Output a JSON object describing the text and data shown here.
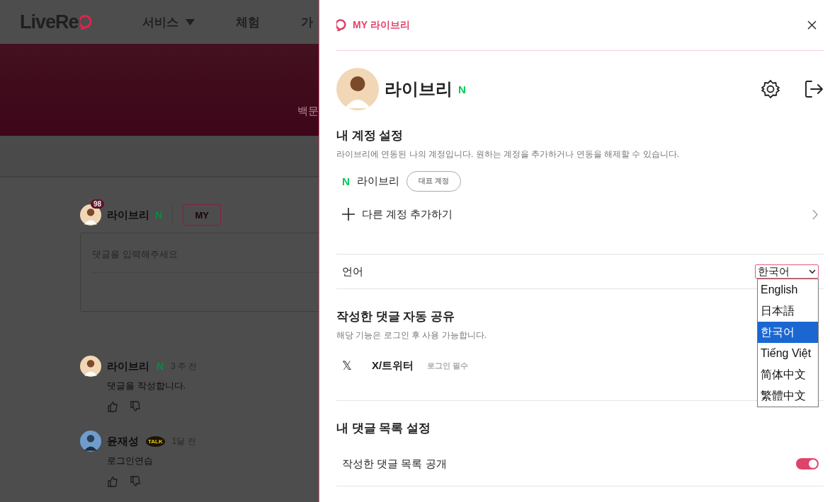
{
  "background_page": {
    "logo": "LiveRe",
    "nav": [
      {
        "label": "서비스",
        "dropdown": true
      },
      {
        "label": "체험",
        "dropdown": false
      },
      {
        "label": "가",
        "dropdown": false
      }
    ],
    "hero_text": "백문",
    "composer": {
      "user": "라이브리",
      "badge": "98",
      "provider": "N",
      "my_button": "MY",
      "placeholder": "댓글을 입력해주세요"
    },
    "comments": [
      {
        "user": "라이브리",
        "kind": "naver",
        "provider_label": "N",
        "time": "3 주 전",
        "text": "댓글을 작성합니다."
      },
      {
        "user": "윤재성",
        "kind": "kakao",
        "provider_label": "TALK",
        "time": "1달 전",
        "text": "로그인연습"
      }
    ]
  },
  "panel": {
    "title": "MY 라이브리",
    "profile": {
      "name": "라이브리",
      "provider": "N"
    },
    "account_section": {
      "title": "내 계정 설정",
      "description": "라이브리에 연동된 나의 계정입니다. 원하는 계정을 추가하거나 연동을 해제할 수 있습니다.",
      "accounts": [
        {
          "provider": "N",
          "name": "라이브리",
          "tag": "대표 계정"
        }
      ],
      "add_account": "다른 계정 추가하기"
    },
    "language": {
      "label": "언어",
      "value": "한국어",
      "expanded": true,
      "options": [
        {
          "label": "English",
          "selected": false
        },
        {
          "label": "日本語",
          "selected": false
        },
        {
          "label": "한국어",
          "selected": true
        },
        {
          "label": "Tiếng Việt",
          "selected": false
        },
        {
          "label": "简体中文",
          "selected": false
        },
        {
          "label": "繁體中文",
          "selected": false
        }
      ]
    },
    "share_section": {
      "title": "작성한 댓글 자동 공유",
      "description": "해당 기능은 로그인 후 사용 가능합니다.",
      "services": [
        {
          "icon": "𝕏",
          "name": "X/트위터",
          "note": "로그인 필수"
        }
      ]
    },
    "list_section": {
      "title": "내 댓글 목록 설정",
      "settings": [
        {
          "label": "작성한 댓글 목록 공개",
          "on": true
        }
      ]
    }
  }
}
